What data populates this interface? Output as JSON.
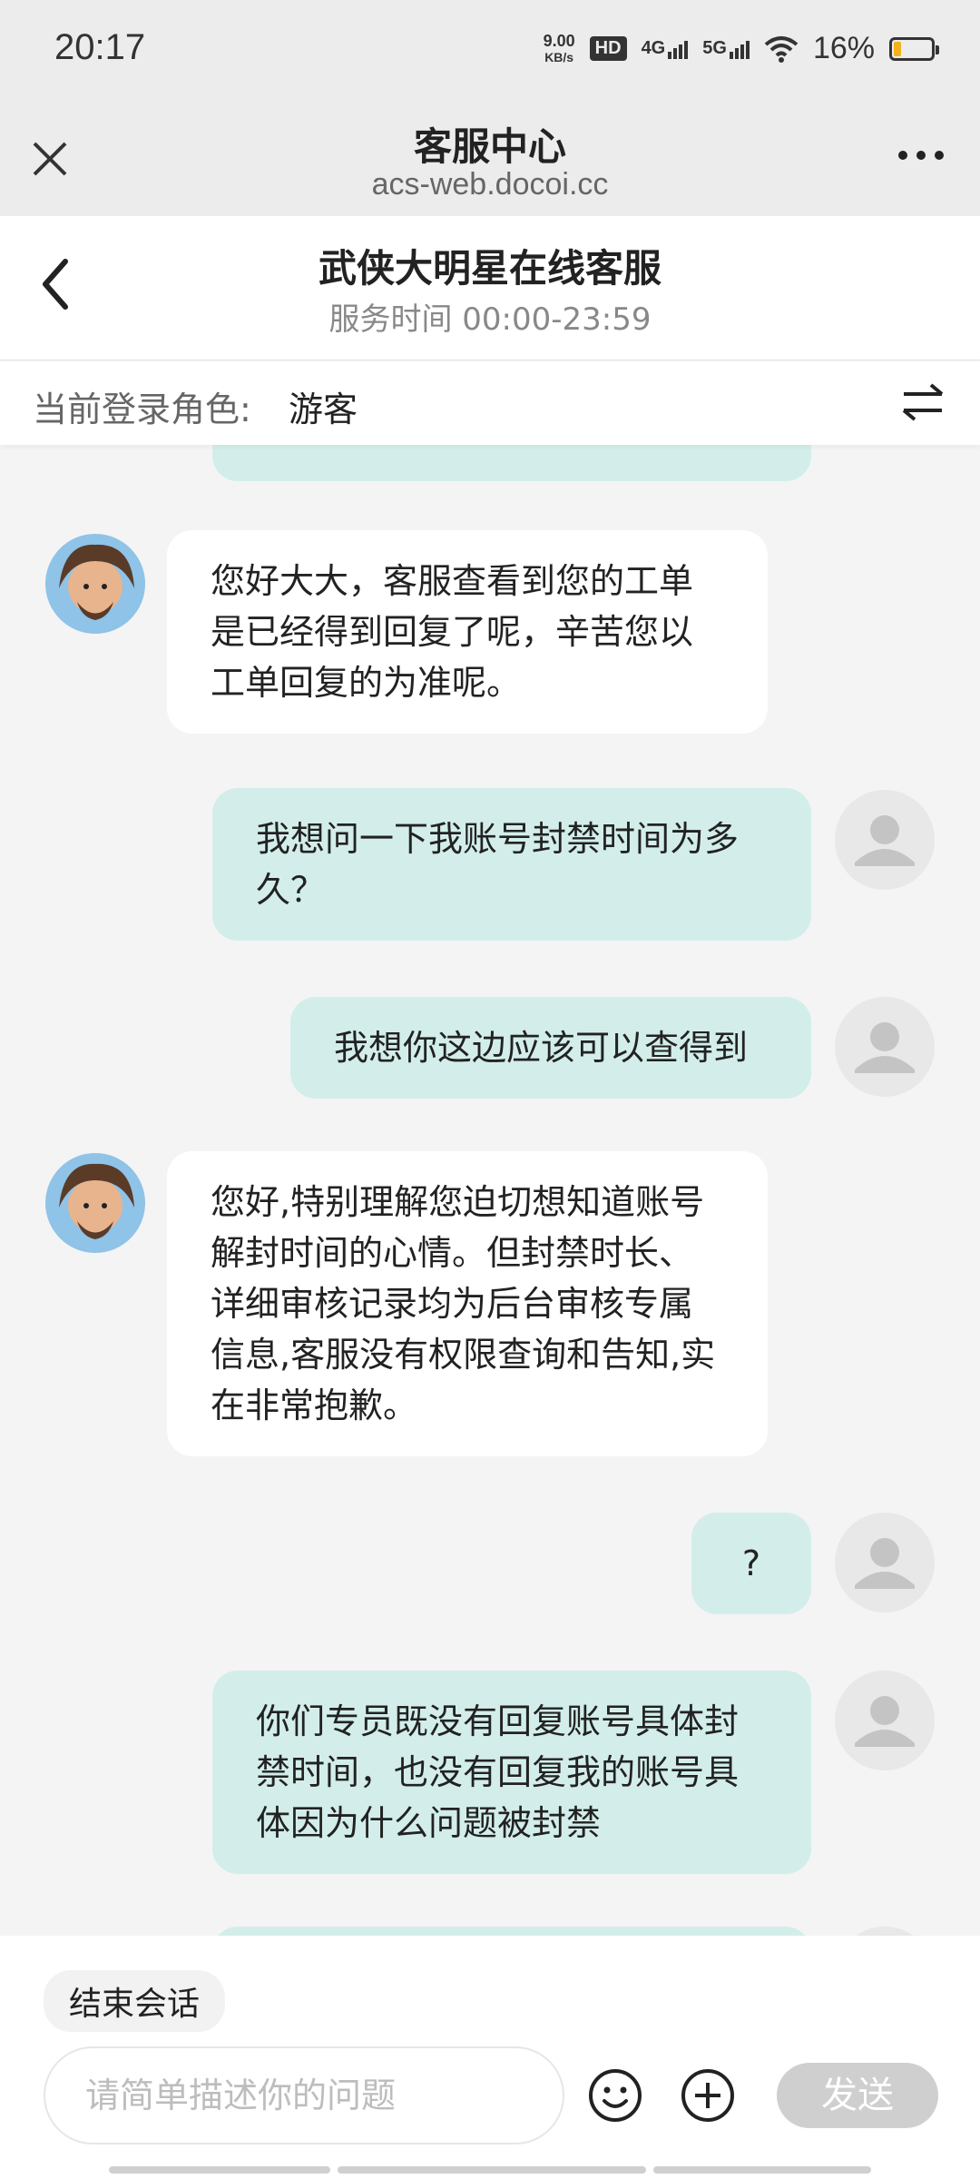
{
  "status": {
    "time": "20:17",
    "speed_value": "9.00",
    "speed_unit": "KB/s",
    "hd": "HD",
    "net1": "4G",
    "net2": "5G",
    "battery": "16%",
    "battery_color": "#f2b21b"
  },
  "browser": {
    "title": "客服中心",
    "url": "acs-web.docoi.cc",
    "close_icon": "close-icon",
    "more_icon": "more-icon"
  },
  "header": {
    "title": "武侠大明星在线客服",
    "subtitle": "服务时间 00:00-23:59"
  },
  "role": {
    "label": "当前登录角色:",
    "value": "游客"
  },
  "messages": [
    {
      "from": "bot",
      "text": "您好大大，客服查看到您的工单是已经得到回复了呢，辛苦您以工单回复的为准呢。"
    },
    {
      "from": "user",
      "text": "我想问一下我账号封禁时间为多久？"
    },
    {
      "from": "user",
      "text": "我想你这边应该可以查得到"
    },
    {
      "from": "bot",
      "text": "您好,特别理解您迫切想知道账号解封时间的心情。但封禁时长、详细审核记录均为后台审核专属信息,客服没有权限查询和告知,实在非常抱歉。"
    },
    {
      "from": "user",
      "text": "?"
    },
    {
      "from": "user",
      "text": "你们专员既没有回复账号具体封禁时间，也没有回复我的账号具体因为什么问题被封禁"
    }
  ],
  "bottom": {
    "end_chat": "结束会话",
    "input_placeholder": "请简单描述你的问题",
    "send": "发送"
  },
  "colors": {
    "user_bubble": "#d3eeea",
    "bot_bubble": "#ffffff",
    "send_disabled": "#cfcfcf"
  }
}
